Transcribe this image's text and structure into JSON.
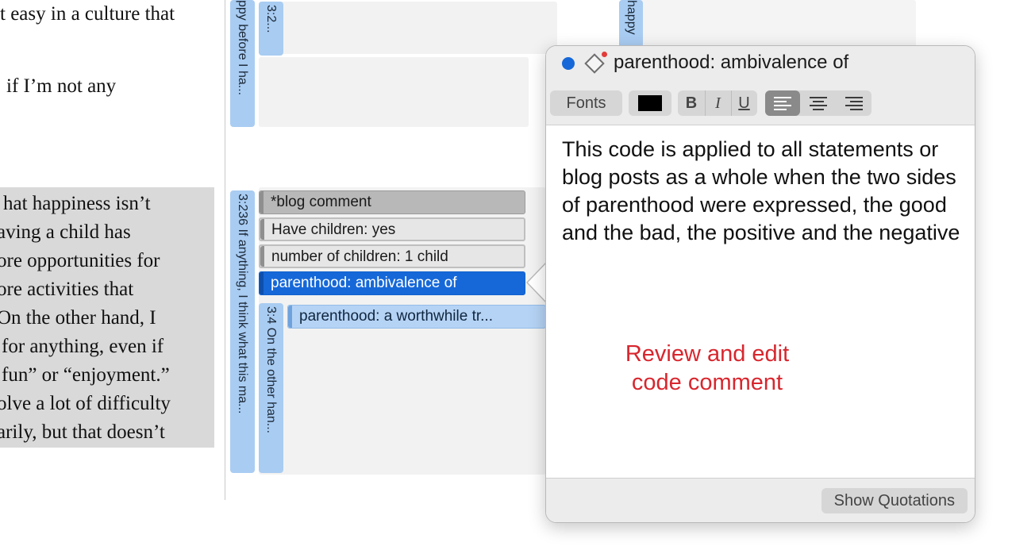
{
  "document": {
    "lines_top": [
      "t easy in a culture that",
      "if I’m not any"
    ],
    "lines_highlighted": [
      "hat happiness isn’t",
      "aving a child has",
      "ore opportunities for",
      "ore activities that",
      "On the other hand, I",
      "for anything, even if",
      "fun” or “enjoyment.”",
      "olve a lot of difficulty",
      "arily, but that doesn’t"
    ]
  },
  "margin": {
    "quotes": [
      {
        "label": "ppy before I ha..."
      },
      {
        "label": "3:2..."
      },
      {
        "label": "happy"
      },
      {
        "label": "3:236 If anything, I think what this ma..."
      },
      {
        "label": "3:4 On the other han..."
      }
    ],
    "codes": [
      {
        "label": "*blog comment"
      },
      {
        "label": "Have children: yes"
      },
      {
        "label": "number of children: 1 child"
      },
      {
        "label": "parenthood: ambivalence of"
      },
      {
        "label": "parenthood: a worthwhile tr..."
      }
    ]
  },
  "popover": {
    "title": "parenthood: ambivalence of",
    "toolbar": {
      "fonts_label": "Fonts",
      "text_color": "#000000",
      "bold": "B",
      "italic": "I",
      "underline": "U",
      "align_active": "left"
    },
    "comment": "This code is applied to all statements or blog posts as a whole when the two sides of parenthood were expressed, the good and the bad, the positive and the negative",
    "annotation": "Review and edit code comment",
    "show_quotations_label": "Show Quotations"
  },
  "colors": {
    "selected_code": "#1668d8",
    "quote_bar": "#a9ccf2",
    "annotation": "#d8262e"
  }
}
